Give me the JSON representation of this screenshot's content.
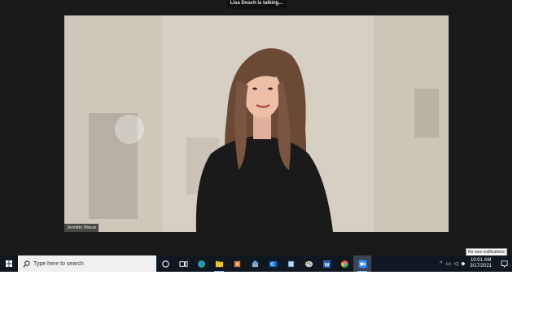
{
  "meeting": {
    "talking_banner": "Lisa Dosch is talking...",
    "participant_name": "Jennifer Macar"
  },
  "taskbar": {
    "search_placeholder": "Type here to search",
    "pinned_apps": [
      {
        "name": "cortana-icon"
      },
      {
        "name": "task-view-icon"
      },
      {
        "name": "edge-icon"
      },
      {
        "name": "file-explorer-icon"
      },
      {
        "name": "photos-icon"
      },
      {
        "name": "snipping-tool-icon"
      },
      {
        "name": "outlook-icon"
      },
      {
        "name": "onedrive-icon"
      },
      {
        "name": "paint-icon"
      },
      {
        "name": "word-icon"
      },
      {
        "name": "chrome-icon"
      },
      {
        "name": "zoom-icon"
      }
    ],
    "clock_time": "10:01 AM",
    "clock_date": "3/17/2021",
    "notification_tooltip": "No new notifications"
  },
  "colors": {
    "taskbar_bg": "#0f1720",
    "zoom_bg": "#1a1a1a",
    "zoom_blue": "#2d8cff"
  }
}
